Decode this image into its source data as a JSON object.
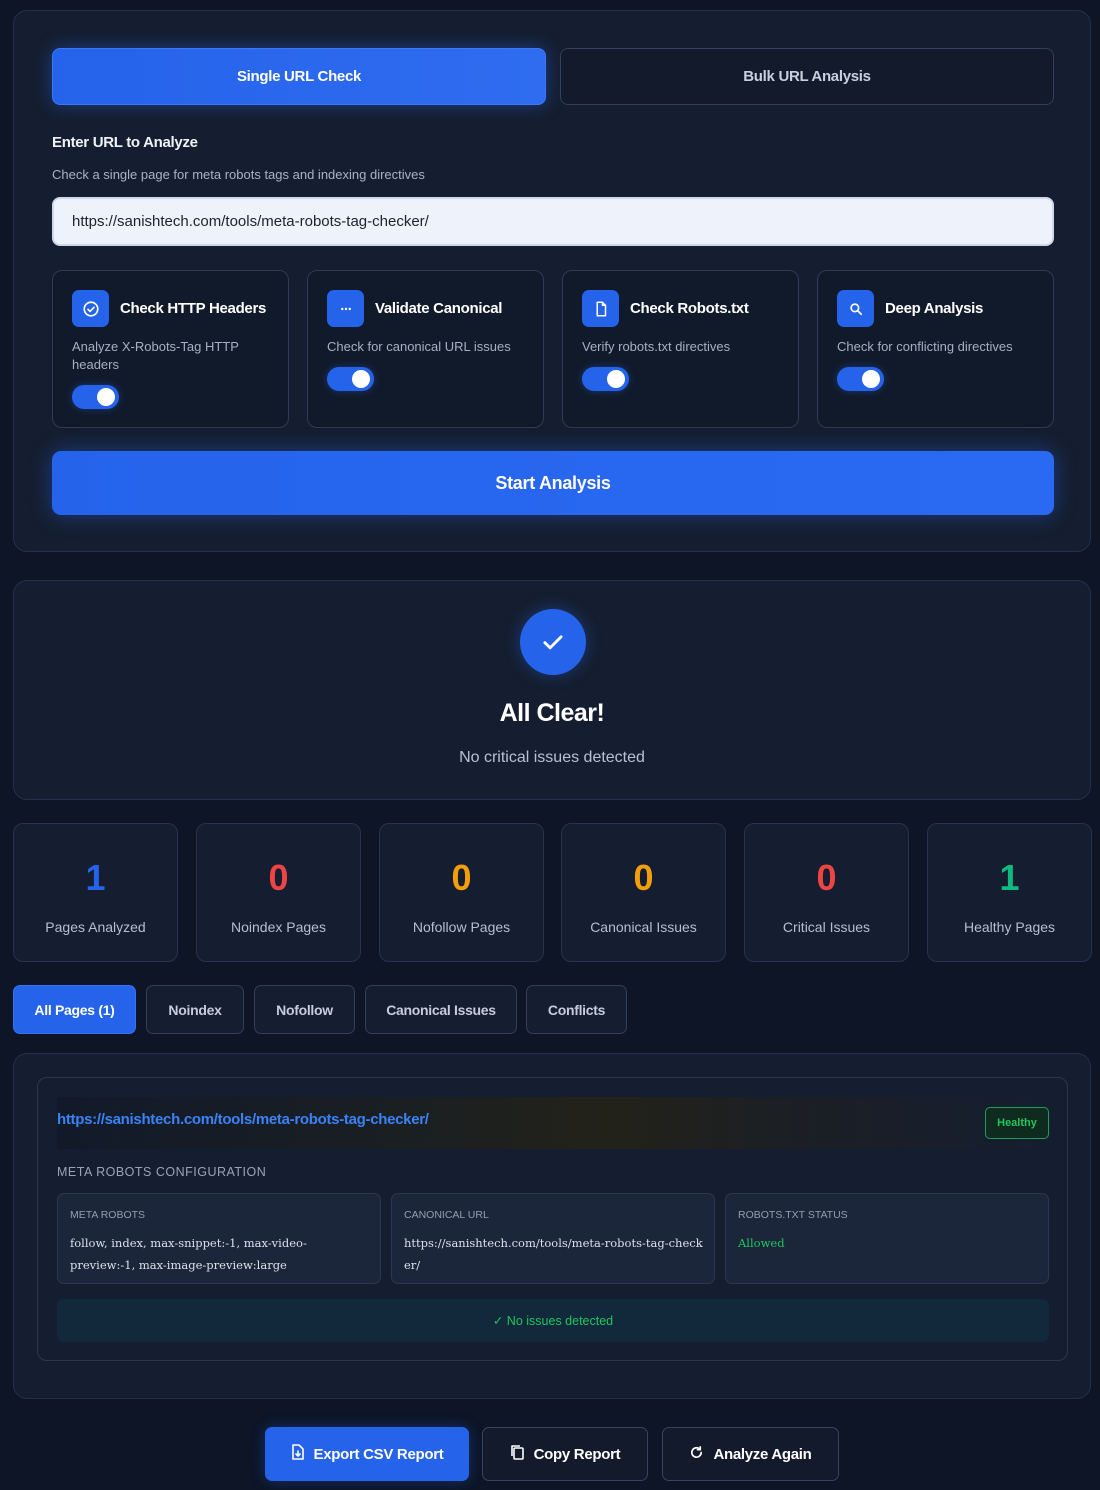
{
  "modes": {
    "single_label": "Single URL Check",
    "bulk_label": "Bulk URL Analysis"
  },
  "input_section": {
    "title": "Enter URL to Analyze",
    "subtitle": "Check a single page for meta robots tags and indexing directives",
    "url_value": "https://sanishtech.com/tools/meta-robots-tag-checker/"
  },
  "options": [
    {
      "title": "Check HTTP Headers",
      "desc": "Analyze X-Robots-Tag HTTP headers",
      "icon": "check-circle-icon",
      "enabled": true
    },
    {
      "title": "Validate Canonical",
      "desc": "Check for canonical URL issues",
      "icon": "dots-icon",
      "enabled": true
    },
    {
      "title": "Check Robots.txt",
      "desc": "Verify robots.txt directives",
      "icon": "file-icon",
      "enabled": true
    },
    {
      "title": "Deep Analysis",
      "desc": "Check for conflicting directives",
      "icon": "search-icon",
      "enabled": true
    }
  ],
  "start_button": "Start Analysis",
  "status": {
    "title": "All Clear!",
    "subtitle": "No critical issues detected"
  },
  "stats": [
    {
      "value": "1",
      "label": "Pages Analyzed",
      "color": "#2563eb"
    },
    {
      "value": "0",
      "label": "Noindex Pages",
      "color": "#ef4444"
    },
    {
      "value": "0",
      "label": "Nofollow Pages",
      "color": "#f59e0b"
    },
    {
      "value": "0",
      "label": "Canonical Issues",
      "color": "#f59e0b"
    },
    {
      "value": "0",
      "label": "Critical Issues",
      "color": "#ef4444"
    },
    {
      "value": "1",
      "label": "Healthy Pages",
      "color": "#10b981"
    }
  ],
  "filters": [
    "All Pages (1)",
    "Noindex",
    "Nofollow",
    "Canonical Issues",
    "Conflicts"
  ],
  "result": {
    "url": "https://sanishtech.com/tools/meta-robots-tag-checker/",
    "badge": "Healthy",
    "config_title": "META ROBOTS CONFIGURATION",
    "meta_robots_label": "META ROBOTS",
    "meta_robots_value": "follow, index, max-snippet:-1, max-video-preview:-1, max-image-preview:large",
    "canonical_label": "CANONICAL URL",
    "canonical_value": "https://sanishtech.com/tools/meta-robots-tag-checker/",
    "robots_label": "ROBOTS.TXT STATUS",
    "robots_value": "Allowed",
    "no_issues": "✓ No issues detected"
  },
  "actions": {
    "export": "Export CSV Report",
    "copy": "Copy Report",
    "again": "Analyze Again"
  }
}
